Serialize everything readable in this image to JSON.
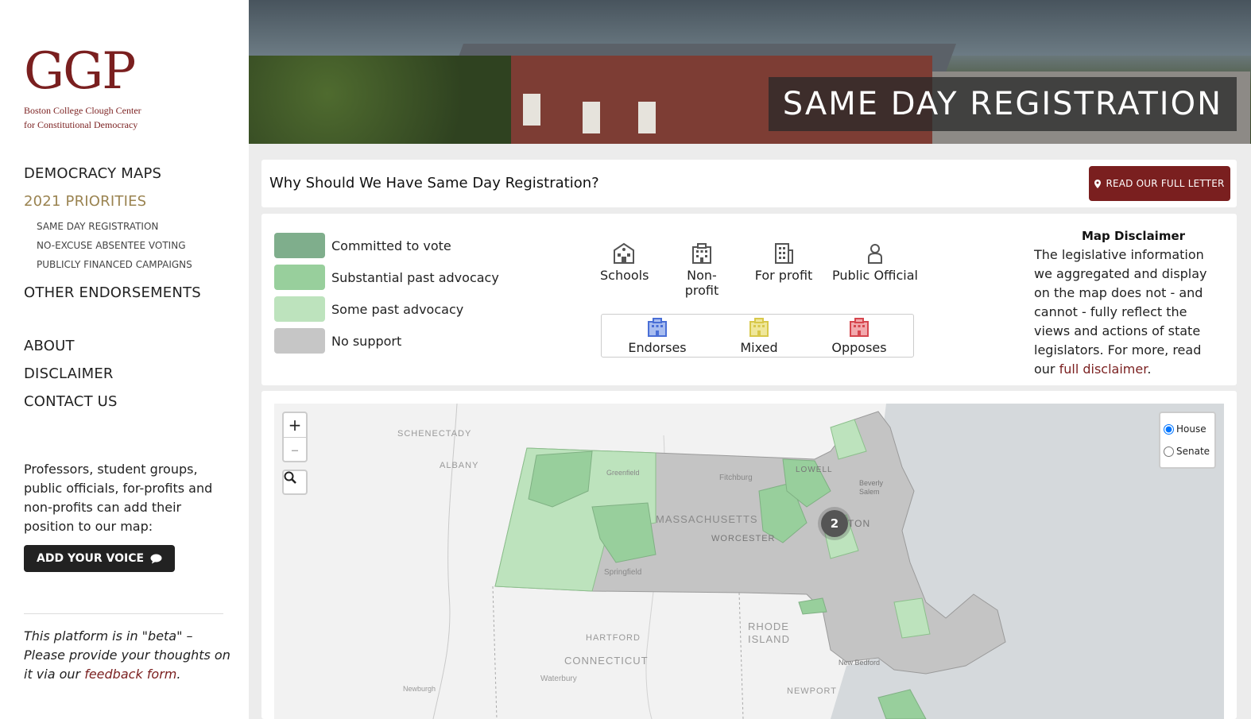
{
  "logo": {
    "mark": "GGP",
    "line1": "Boston College Clough Center",
    "line2": "for Constitutional Democracy"
  },
  "nav": {
    "democracy_maps": "DEMOCRACY MAPS",
    "priorities": "2021 PRIORITIES",
    "sub_items": [
      "SAME DAY REGISTRATION",
      "NO-EXCUSE ABSENTEE VOTING",
      "PUBLICLY FINANCED CAMPAIGNS"
    ],
    "other_endorsements": "OTHER ENDORSEMENTS",
    "about": "ABOUT",
    "disclaimer": "DISCLAIMER",
    "contact": "CONTACT US"
  },
  "cta": {
    "text": "Professors, student groups, public officials, for-profits and non-profits can add their position to our map:",
    "button": "ADD YOUR VOICE"
  },
  "beta": {
    "text_before": "This platform is in \"beta\" – Please provide your thoughts on it via our ",
    "link": "feedback form",
    "text_after": "."
  },
  "hero": {
    "title": "SAME DAY REGISTRATION"
  },
  "question": {
    "title": "Why Should We Have Same Day Registration?",
    "button": "READ OUR FULL LETTER"
  },
  "legend": {
    "levels": [
      {
        "label": "Committed to vote",
        "color": "#7fae8c"
      },
      {
        "label": "Substantial past advocacy",
        "color": "#98cf9c"
      },
      {
        "label": "Some past advocacy",
        "color": "#bde3bd"
      },
      {
        "label": "No support",
        "color": "#c6c6c6"
      }
    ],
    "types": [
      {
        "label": "Schools",
        "icon": "school-icon"
      },
      {
        "label": "Non-profit",
        "icon": "building-icon"
      },
      {
        "label": "For profit",
        "icon": "office-tower-icon"
      },
      {
        "label": "Public Official",
        "icon": "person-icon"
      }
    ],
    "stances": [
      {
        "label": "Endorses",
        "color": "#4a6fd6"
      },
      {
        "label": "Mixed",
        "color": "#d8c84a"
      },
      {
        "label": "Opposes",
        "color": "#d6474f"
      }
    ]
  },
  "disclaimer": {
    "title": "Map Disclaimer",
    "text": "The legislative information we aggregated and display on the map does not - and cannot - fully reflect the views and actions of state legislators. For more, read our ",
    "link": "full disclaimer",
    "after": "."
  },
  "map": {
    "zoom_in": "+",
    "zoom_out": "–",
    "chamber_options": [
      "House",
      "Senate"
    ],
    "selected_chamber": "House",
    "cluster_count": "2",
    "labels": {
      "schenectady": "SCHENECTADY",
      "albany": "ALBANY",
      "massachusetts": "MASSACHUSETTS",
      "worcester": "WORCESTER",
      "springfield": "Springfield",
      "fitchburg": "Fitchburg",
      "greenfield": "Greenfield",
      "lowell": "LOWELL",
      "beverly": "Beverly",
      "salem": "Salem",
      "boston": "TON",
      "hartford": "HARTFORD",
      "connecticut": "CONNECTICUT",
      "rhode": "RHODE",
      "island": "ISLAND",
      "waterbury": "Waterbury",
      "newburgh": "Newburgh",
      "newport": "NEWPORT",
      "new_bedford": "New Bedford"
    }
  }
}
